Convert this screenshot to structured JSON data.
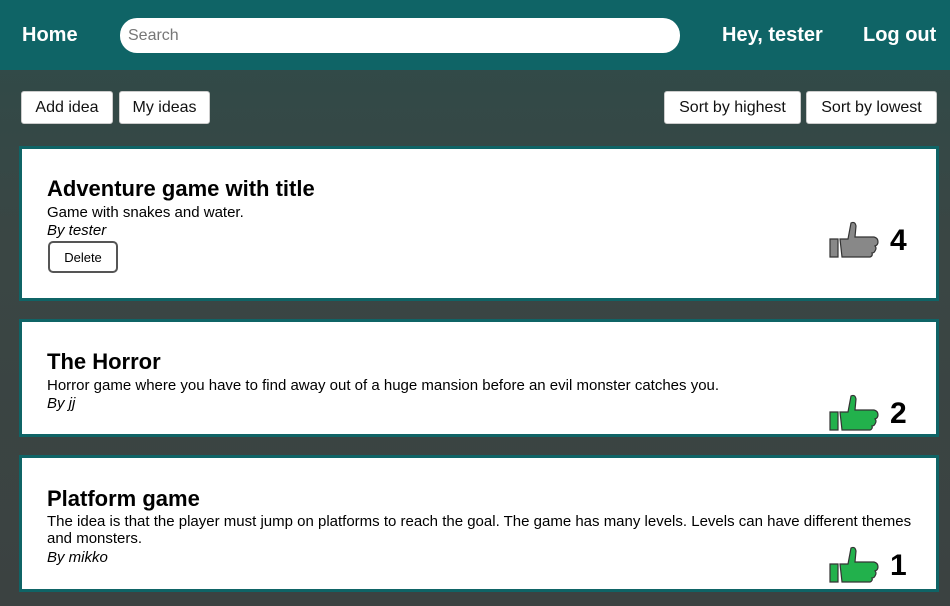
{
  "nav": {
    "home_label": "Home",
    "search_placeholder": "Search",
    "greeting": "Hey, tester",
    "logout_label": "Log out"
  },
  "toolbar": {
    "add_idea_label": "Add idea",
    "my_ideas_label": "My ideas",
    "sort_highest_label": "Sort by highest",
    "sort_lowest_label": "Sort by lowest"
  },
  "ideas": [
    {
      "title": "Adventure game with title",
      "description": "Game with snakes and water.",
      "author": "By tester",
      "delete_label": "Delete",
      "votes": "4",
      "thumb_icon": "thumbs-up-icon",
      "thumb_color": "#888888"
    },
    {
      "title": "The Horror",
      "description": "Horror game where you have to find away out of a huge mansion before an evil monster catches you.",
      "author": "By jj",
      "votes": "2",
      "thumb_icon": "thumbs-up-icon",
      "thumb_color": "#22b14c"
    },
    {
      "title": "Platform game",
      "description": "The idea is that the player must jump on platforms to reach the goal. The game has many levels. Levels can have different themes and monsters.",
      "author": "By mikko",
      "votes": "1",
      "thumb_icon": "thumbs-up-icon",
      "thumb_color": "#22b14c"
    }
  ],
  "colors": {
    "brand": "#0f6466",
    "background": "#3a4644"
  }
}
